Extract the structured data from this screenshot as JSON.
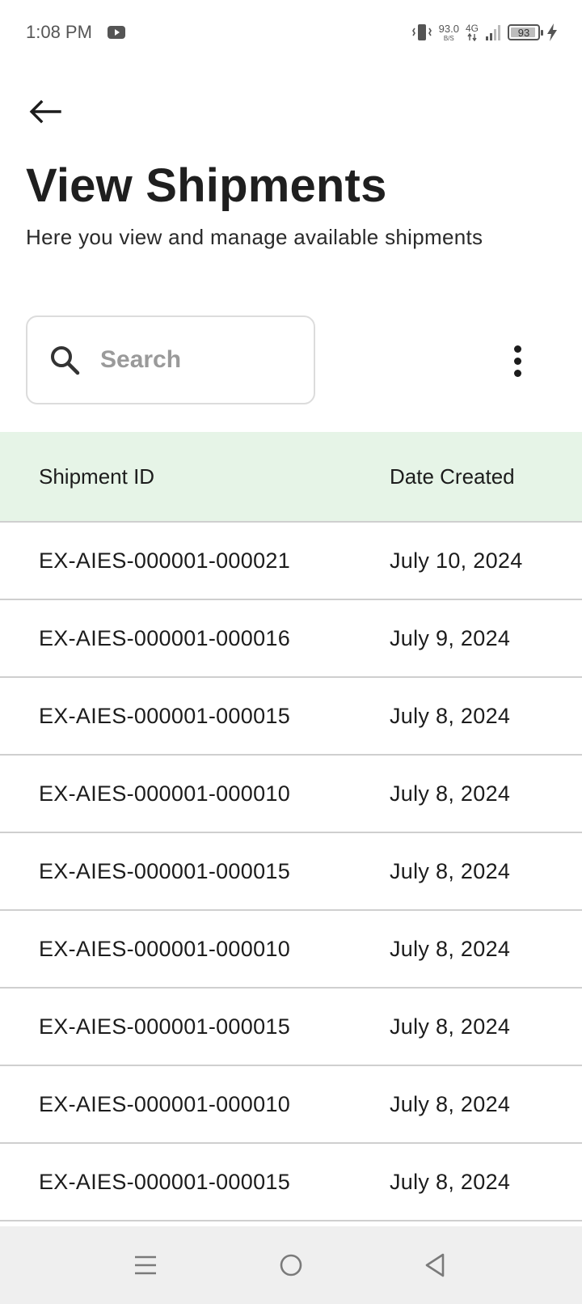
{
  "status_bar": {
    "time": "1:08 PM",
    "net_speed_value": "93.0",
    "net_speed_unit": "B/S",
    "network_type": "4G",
    "battery_level": "93",
    "battery_fraction": 0.93
  },
  "header": {
    "title": "View Shipments",
    "subtitle": "Here you view and manage available shipments"
  },
  "search": {
    "placeholder": "Search",
    "value": ""
  },
  "table": {
    "columns": [
      "Shipment ID",
      "Date Created"
    ],
    "rows": [
      {
        "id": "EX-AIES-000001-000021",
        "date": "July 10, 2024"
      },
      {
        "id": "EX-AIES-000001-000016",
        "date": "July 9, 2024"
      },
      {
        "id": "EX-AIES-000001-000015",
        "date": "July 8, 2024"
      },
      {
        "id": "EX-AIES-000001-000010",
        "date": "July 8, 2024"
      },
      {
        "id": "EX-AIES-000001-000015",
        "date": "July 8, 2024"
      },
      {
        "id": "EX-AIES-000001-000010",
        "date": "July 8, 2024"
      },
      {
        "id": "EX-AIES-000001-000015",
        "date": "July 8, 2024"
      },
      {
        "id": "EX-AIES-000001-000010",
        "date": "July 8, 2024"
      },
      {
        "id": "EX-AIES-000001-000015",
        "date": "July 8, 2024"
      }
    ]
  },
  "colors": {
    "header_row_bg": "#e6f4e7",
    "nav_bar_bg": "#efefef"
  },
  "icons": {
    "back": "arrow-left-icon",
    "search": "search-icon",
    "more": "more-vertical-icon",
    "nav": [
      "menu-icon",
      "home-circle-icon",
      "back-triangle-icon"
    ]
  }
}
